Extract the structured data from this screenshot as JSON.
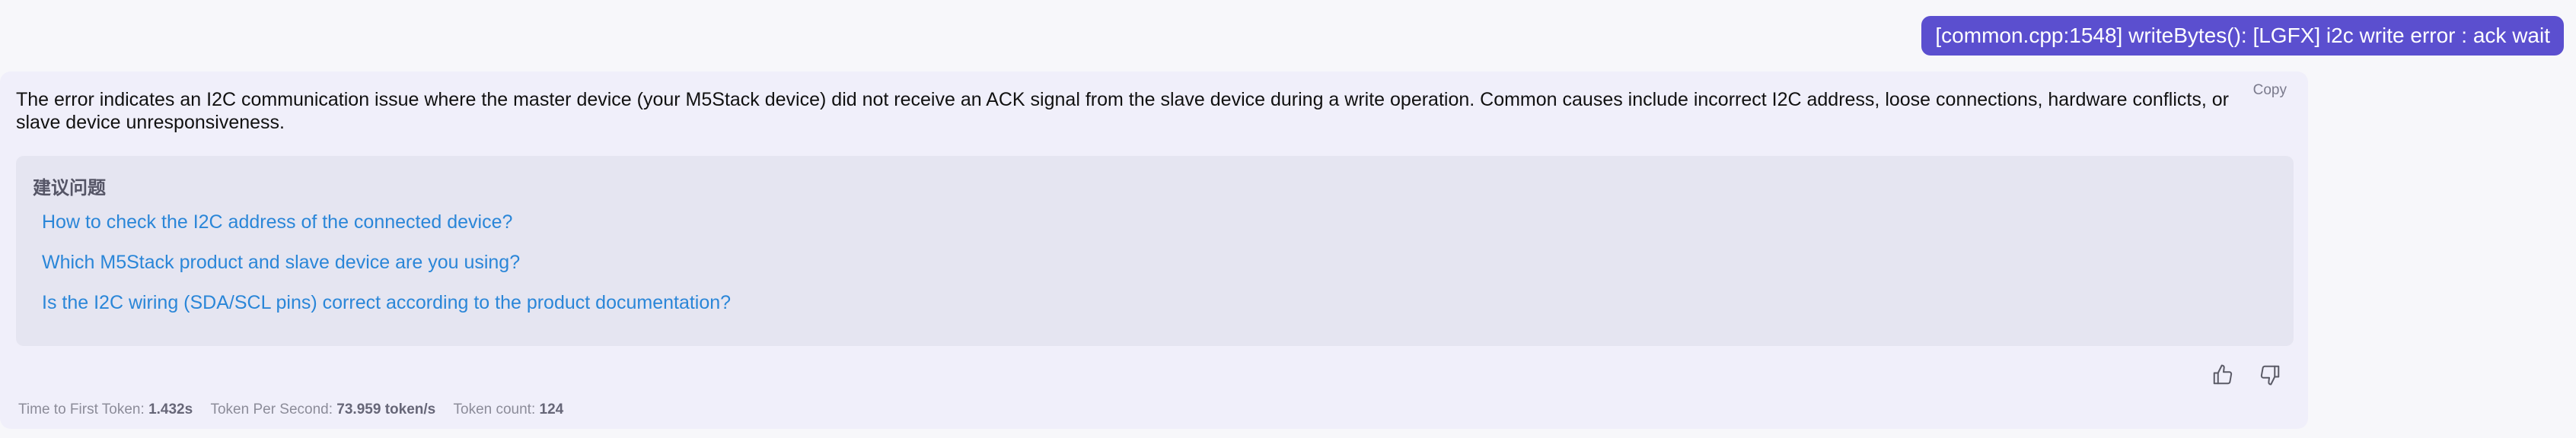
{
  "user_message": "[common.cpp:1548] writeBytes(): [LGFX] i2c write error : ack wait",
  "assistant": {
    "copy_label": "Copy",
    "answer": "The error indicates an I2C communication issue where the master device (your M5Stack device) did not receive an ACK signal from the slave device during a write operation. Common causes include incorrect I2C address, loose connections, hardware conflicts, or slave device unresponsiveness.",
    "suggestions_title": "建议问题",
    "suggestions": [
      "How to check the I2C address of the connected device?",
      "Which M5Stack product and slave device are you using?",
      "Is the I2C wiring (SDA/SCL pins) correct according to the product documentation?"
    ],
    "feedback": {
      "like_icon": "thumbs-up-icon",
      "dislike_icon": "thumbs-down-icon"
    },
    "metrics": {
      "ttft_label": "Time to First Token:",
      "ttft_value": "1.432s",
      "tps_label": "Token Per Second:",
      "tps_value": "73.959 token/s",
      "count_label": "Token count:",
      "count_value": "124"
    }
  },
  "colors": {
    "user_bubble": "#5b4fcf",
    "card_bg": "#f0effa",
    "panel_bg": "#e5e5f1",
    "link": "#2a86d8"
  }
}
